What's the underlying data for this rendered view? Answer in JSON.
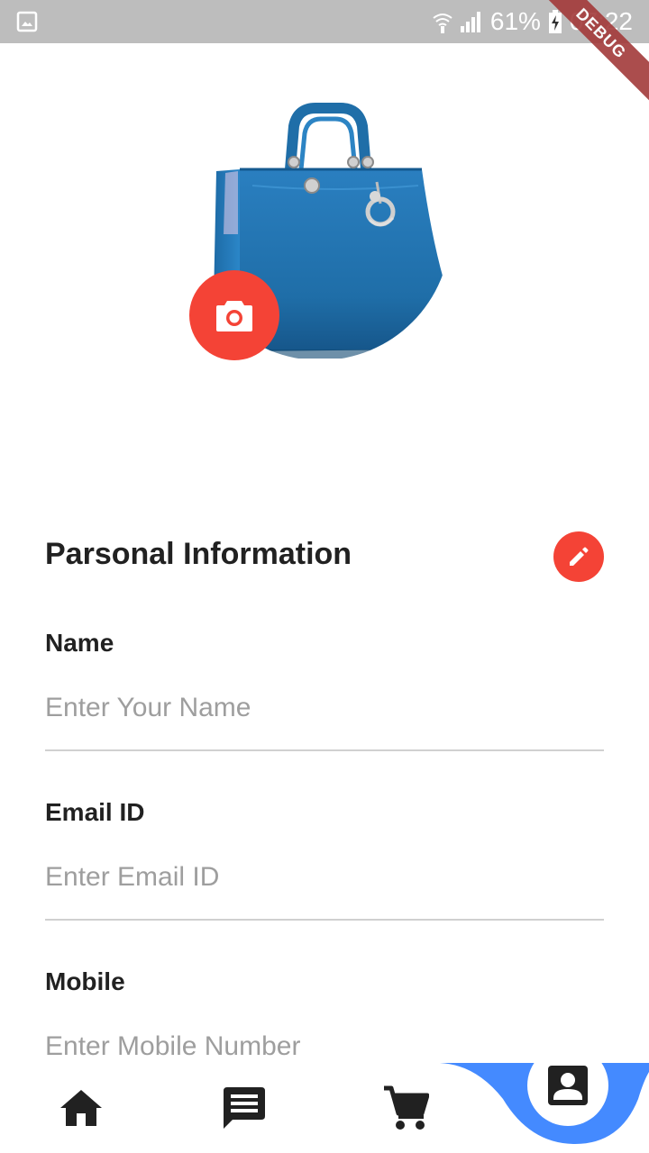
{
  "status_bar": {
    "battery": "61%",
    "time": "07:22",
    "debug_label": "DEBUG"
  },
  "avatar": {
    "camera_icon": "camera-icon"
  },
  "section": {
    "title": "Parsonal Information",
    "edit_icon": "pencil-icon"
  },
  "fields": {
    "name": {
      "label": "Name",
      "placeholder": "Enter Your Name",
      "value": ""
    },
    "email": {
      "label": "Email ID",
      "placeholder": "Enter Email ID",
      "value": ""
    },
    "mobile": {
      "label": "Mobile",
      "placeholder": "Enter Mobile Number",
      "value": ""
    }
  },
  "bottom_nav": {
    "items": [
      "home-icon",
      "chat-icon",
      "cart-icon",
      "account-box-icon"
    ],
    "active": "account-box-icon",
    "accent": "#448aff"
  },
  "colors": {
    "accent_red": "#f44336",
    "status_bar": "#bdbdbd",
    "debug_banner": "#a33a3a"
  }
}
